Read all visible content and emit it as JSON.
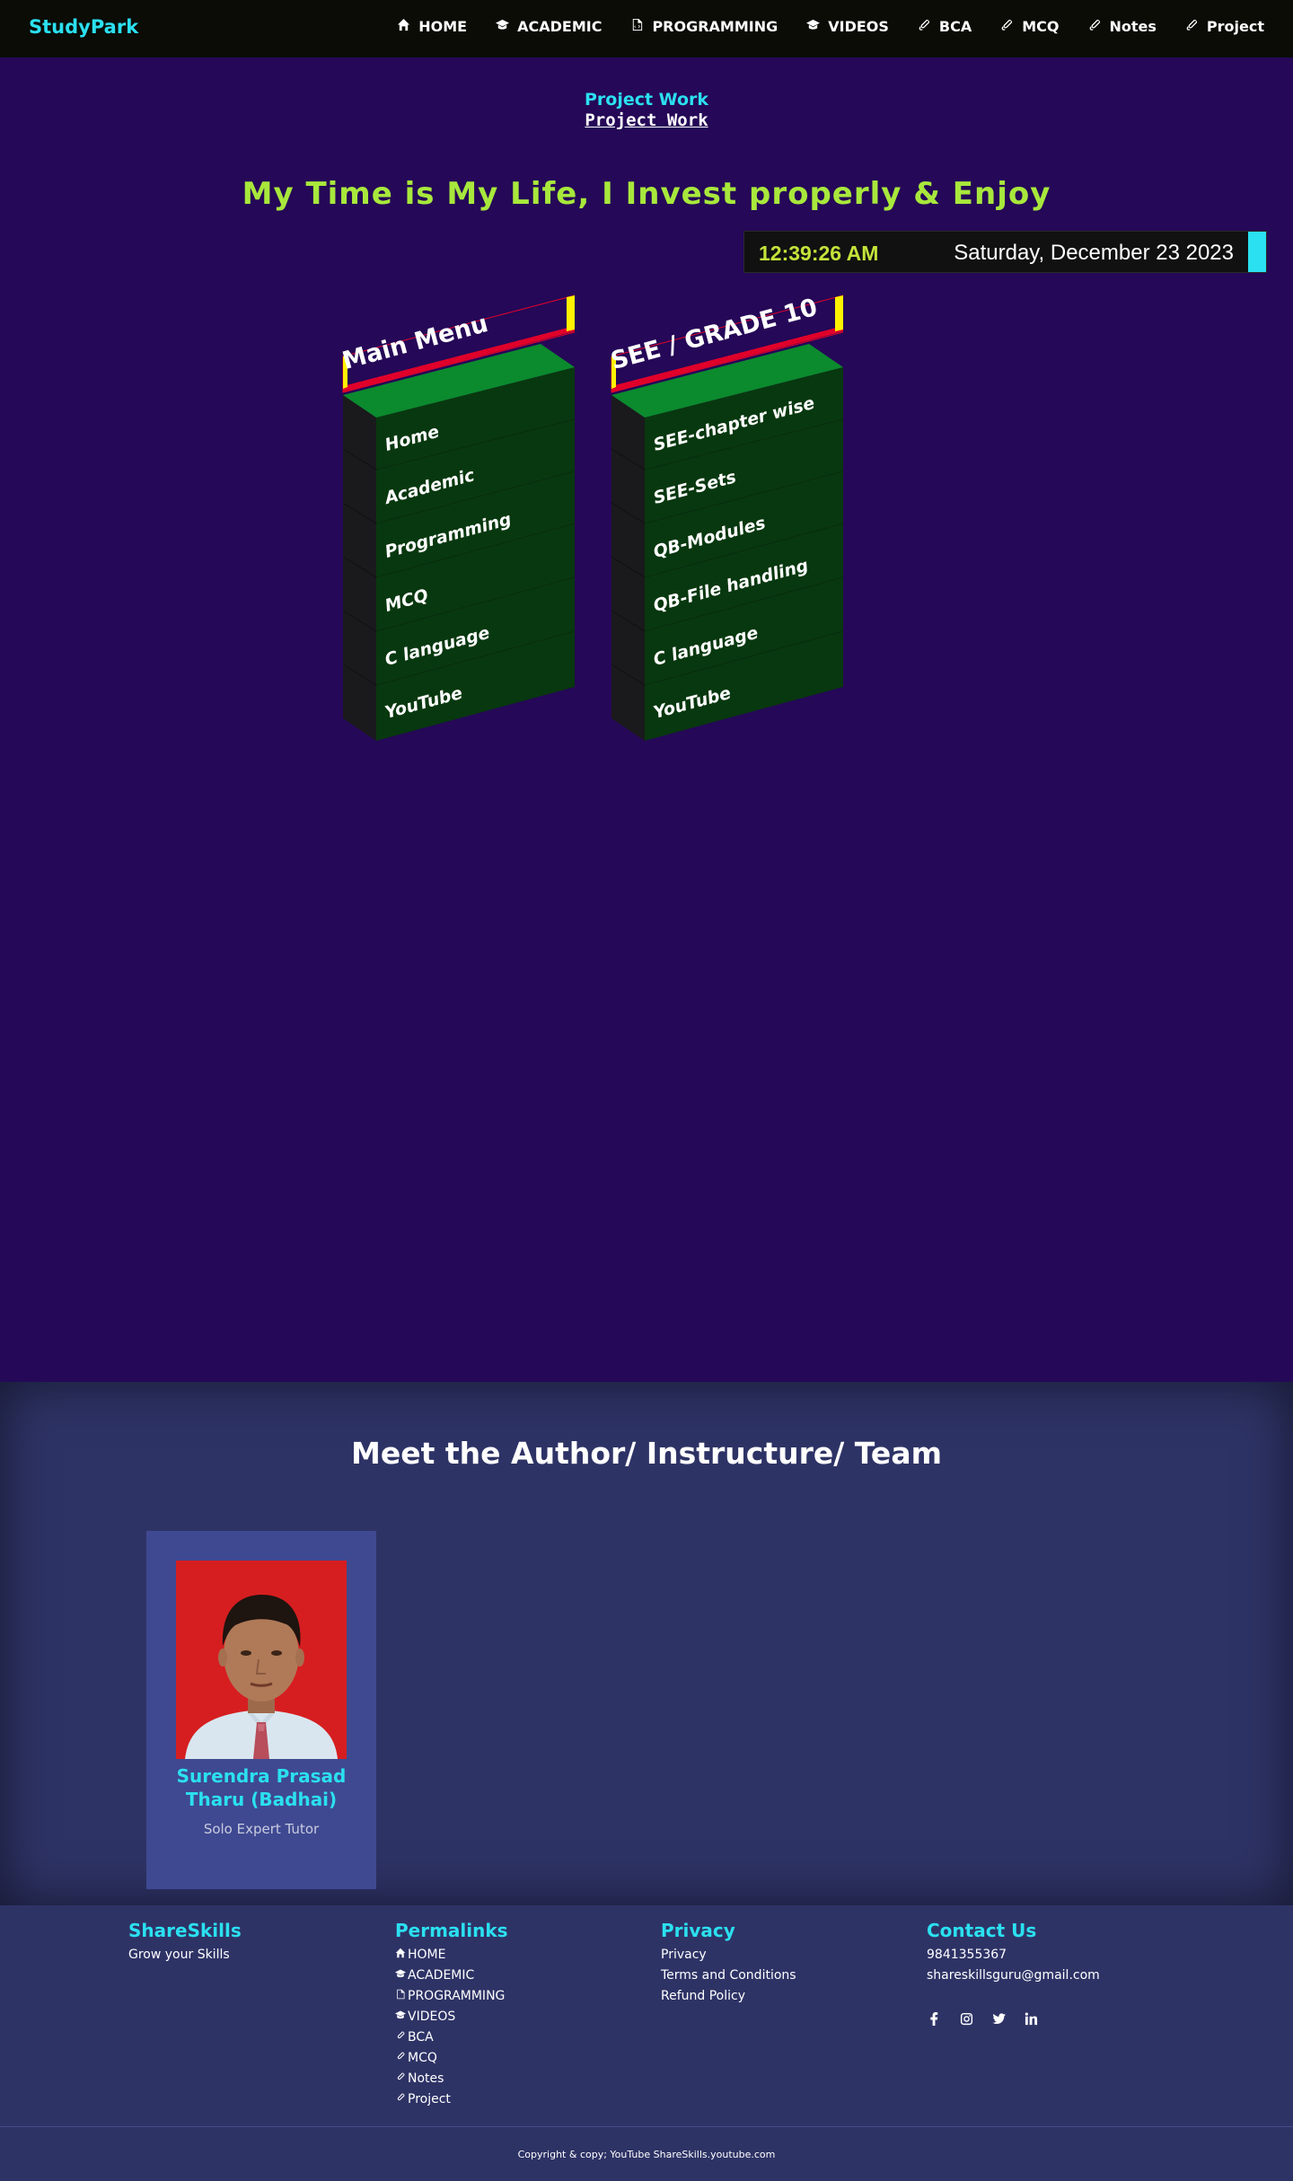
{
  "nav": {
    "brand": "StudyPark",
    "items": [
      {
        "label": "HOME",
        "icon": "home-icon"
      },
      {
        "label": "ACADEMIC",
        "icon": "graduation-cap-icon"
      },
      {
        "label": "PROGRAMMING",
        "icon": "code-file-icon"
      },
      {
        "label": "VIDEOS",
        "icon": "graduation-cap-icon"
      },
      {
        "label": "BCA",
        "icon": "paperclip-icon"
      },
      {
        "label": "MCQ",
        "icon": "paperclip-icon"
      },
      {
        "label": "Notes",
        "icon": "paperclip-icon"
      },
      {
        "label": "Project",
        "icon": "paperclip-icon"
      }
    ]
  },
  "header": {
    "section_title": "Project Work",
    "section_link": "Project Work",
    "tagline": "My Time is My Life, I Invest properly & Enjoy"
  },
  "clock": {
    "time": "12:39:26 AM",
    "date": "Saturday, December 23 2023"
  },
  "menus": [
    {
      "title": "Main Menu",
      "items": [
        "Home",
        "Academic",
        "Programming",
        "MCQ",
        "C language",
        "YouTube"
      ]
    },
    {
      "title": "SEE / GRADE 10",
      "items": [
        "SEE-chapter wise",
        "SEE-Sets",
        "QB-Modules",
        "QB-File handling",
        "C language",
        "YouTube"
      ]
    }
  ],
  "author": {
    "heading": "Meet the Author/ Instructure/ Team",
    "name": "Surendra Prasad Tharu (Badhai)",
    "role": "Solo Expert Tutor"
  },
  "footer": {
    "brand": {
      "title": "ShareSkills",
      "text": "Grow your Skills"
    },
    "permalinks": {
      "title": "Permalinks",
      "items": [
        {
          "label": "HOME",
          "icon": "home-icon"
        },
        {
          "label": "ACADEMIC",
          "icon": "graduation-cap-icon"
        },
        {
          "label": "PROGRAMMING",
          "icon": "code-file-icon"
        },
        {
          "label": "VIDEOS",
          "icon": "graduation-cap-icon"
        },
        {
          "label": "BCA",
          "icon": "paperclip-icon"
        },
        {
          "label": "MCQ",
          "icon": "paperclip-icon"
        },
        {
          "label": "Notes",
          "icon": "paperclip-icon"
        },
        {
          "label": "Project",
          "icon": "paperclip-icon"
        }
      ]
    },
    "privacy": {
      "title": "Privacy",
      "items": [
        "Privacy",
        "Terms and Conditions",
        "Refund Policy"
      ]
    },
    "contact": {
      "title": "Contact Us",
      "phone": "9841355367",
      "email": "shareskillsguru@gmail.com",
      "social": [
        "facebook-icon",
        "instagram-icon",
        "twitter-icon",
        "linkedin-icon"
      ]
    },
    "copyright": "Copyright & copy; YouTube ShareSkills.youtube.com"
  },
  "colors": {
    "accent": "#2be0f0",
    "tagline": "#a8e83c",
    "page_bg": "#250857",
    "section_bg": "#2e3366",
    "menu_green": "#0b8a2e",
    "menu_header_yellow": "#fff200",
    "menu_header_red": "#e0002a"
  }
}
